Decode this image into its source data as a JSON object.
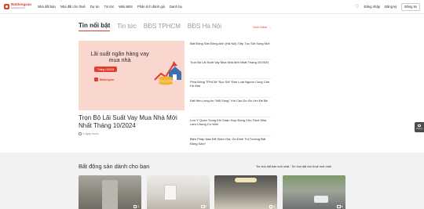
{
  "header": {
    "logo_name": "Batdongsan",
    "logo_sub": "byPropertyGuru",
    "nav": [
      "Nhà đất bán",
      "Nhà đất cho thuê",
      "Dự án",
      "Tin tức",
      "Wiki BĐS",
      "Phân tích đánh giá",
      "Danh bạ"
    ],
    "login": "Đăng nhập",
    "register": "Đăng ký",
    "post": "Đăng tin"
  },
  "news": {
    "tabs": [
      "Tin nổi bật",
      "Tin tức",
      "BĐS TPHCM",
      "BĐS Hà Nội"
    ],
    "see_more": "Xem thêm →",
    "banner": {
      "headline": "Lãi suất ngân hàng vay mua nhà",
      "pill": "Tháng 10/2024",
      "brand": "Batdongsan"
    },
    "main_title": "Trọn Bộ Lãi Suất Vay Mua Nhà Mới Nhất Tháng 10/2024",
    "main_time": "4 ngày trước",
    "list": [
      "Bất Động Sản Đông Anh (Hà Nội) Tiếp Tục Sốt Sóng Mới",
      "Trọn Bộ Lãi Suất Vay Mua Nhà Mới Nhất Tháng 10/2024",
      "Phía Đông TPHCM “Sục Sôi” Đón Loạt Nguồn Cung Căn Hộ Mới",
      "Đất Nền Long An “Nổi Sóng” Với Các Dự Án Lên Đế Bè",
      "Lưu Ý Quan Trọng Khi Soạn Hợp Đồng Cho Thuê Nhà Làm Chung Cư Mini",
      "Biện Pháp Nào Để Giảm Giá, Ổn Định Thị Trường Bất Động Sản?"
    ]
  },
  "side_widget": {
    "label": "Góp ý"
  },
  "recommend": {
    "title": "Bất động sản dành cho bạn",
    "link_sale": "Tin nhà đất bán mới nhất",
    "link_rent": "Tin nhà đất cho thuê mới nhất",
    "sep": "|",
    "cards": [
      {
        "photo_count": "4"
      },
      {
        "photo_count": "8"
      },
      {
        "photo_count": "8"
      },
      {
        "photo_count": "6"
      }
    ]
  },
  "colors": {
    "brand": "#e03c31",
    "banner_bg": "#f9d7cf"
  }
}
